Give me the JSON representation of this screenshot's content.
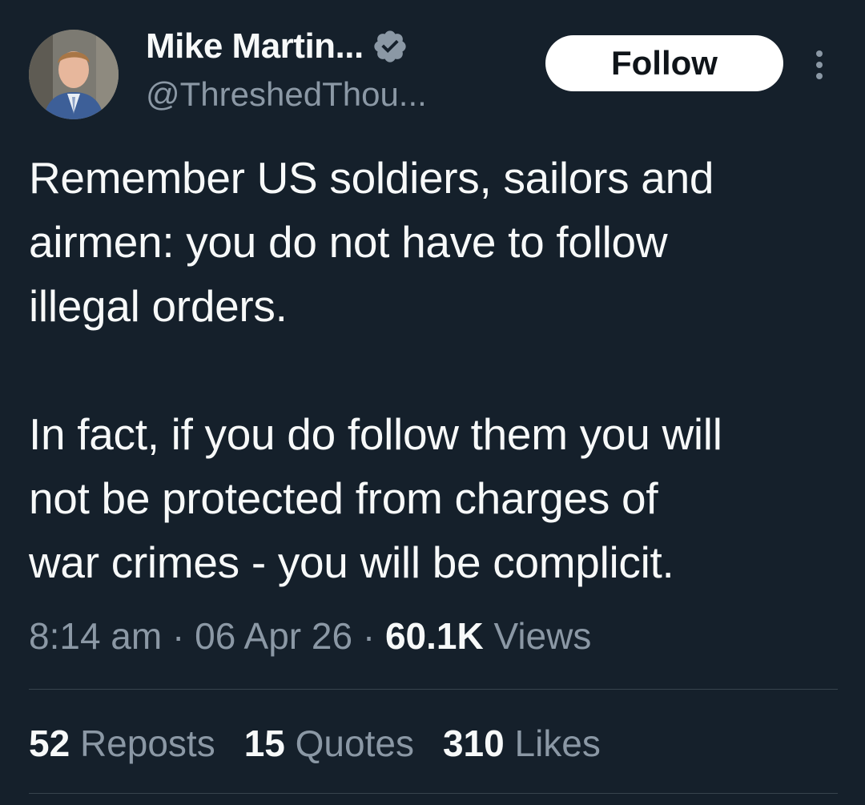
{
  "author": {
    "display_name": "Mike Martin...",
    "handle": "@ThreshedThou...",
    "verified": true,
    "verified_color": "#8b98a5"
  },
  "follow_button": {
    "label": "Follow"
  },
  "more_menu": {
    "icon": "more-vertical-icon"
  },
  "tweet": {
    "paragraphs": [
      "Remember US soldiers, sailors and\nairmen: you do not have to follow\nillegal orders.",
      "In fact, if you do follow them you will\nnot be protected from charges of\nwar crimes - you will be complicit."
    ]
  },
  "meta": {
    "time": "8:14 am",
    "sep1": " · ",
    "date": "06 Apr 26",
    "sep2": " · ",
    "views_count": "60.1K",
    "views_label": " Views"
  },
  "stats": [
    {
      "count": "52",
      "label": "Reposts"
    },
    {
      "count": "15",
      "label": "Quotes"
    },
    {
      "count": "310",
      "label": "Likes"
    }
  ],
  "colors": {
    "background": "#15202b",
    "text_primary": "#f7f9f9",
    "text_secondary": "#8b98a5",
    "divider": "#38444d"
  }
}
